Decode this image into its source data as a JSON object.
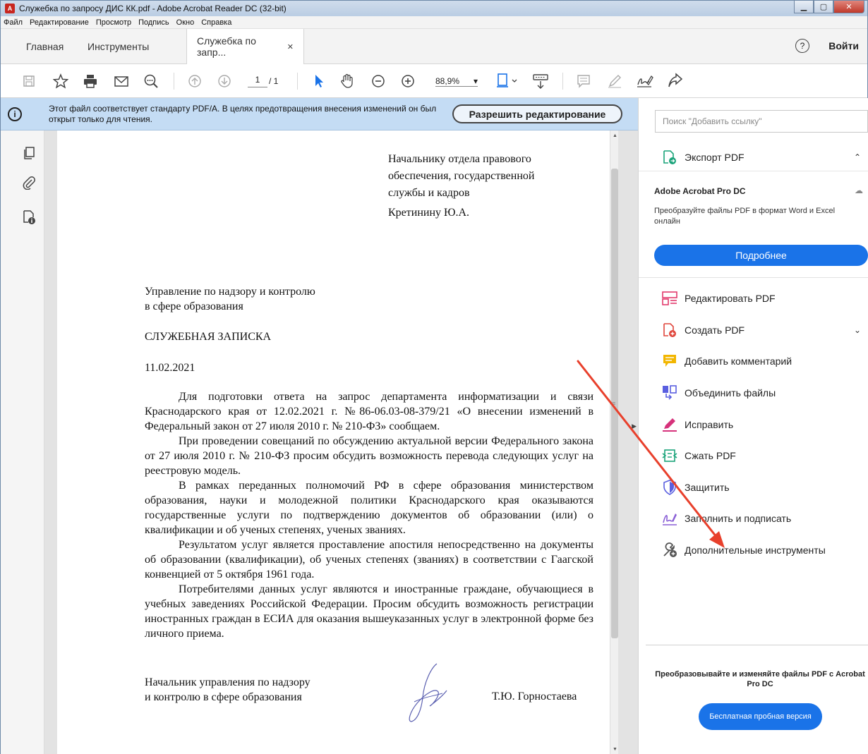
{
  "window": {
    "title": "Служебка по запросу ДИС КК.pdf - Adobe Acrobat Reader DC (32-bit)",
    "app_icon_glyph": "A"
  },
  "menu": [
    "Файл",
    "Редактирование",
    "Просмотр",
    "Подпись",
    "Окно",
    "Справка"
  ],
  "tabs": {
    "home": "Главная",
    "tools": "Инструменты",
    "document": "Служебка по запр...",
    "close_glyph": "✕"
  },
  "header": {
    "help_glyph": "?",
    "login": "Войти"
  },
  "toolbar": {
    "page_current": "1",
    "page_total": "/ 1",
    "zoom": "88,9%",
    "zoom_arrow": "▾"
  },
  "infobar": {
    "icon_glyph": "i",
    "message": "Этот файл соответствует стандарту PDF/A. В целях предотвращения внесения изменений он был открыт только для чтения.",
    "enable_button": "Разрешить редактирование"
  },
  "document": {
    "addressee": [
      "Начальнику отдела правового",
      "обеспечения, государственной",
      "службы и кадров"
    ],
    "addressee_name": "Кретинину Ю.А.",
    "department": [
      "Управление по надзору и контролю",
      "в сфере образования"
    ],
    "title": "СЛУЖЕБНАЯ ЗАПИСКА",
    "date": "11.02.2021",
    "paragraphs": [
      "Для подготовки ответа на запрос департамента информатизации и связи Краснодарского края от 12.02.2021 г. №86-06.03-08-379/21 «О внесении изменений в Федеральный закон от 27 июля 2010 г. № 210-ФЗ» сообщаем.",
      "При проведении совещаний по обсуждению актуальной версии Федерального закона от 27 июля 2010 г. № 210-ФЗ просим обсудить возможность перевода следующих услуг на реестровую модель.",
      "В рамках переданных полномочий РФ в сфере образования министерством образования, науки и молодежной политики Краснодарского края оказываются государственные услуги по подтверждению документов об образовании (или) о квалификации и об ученых степенях, ученых званиях.",
      "Результатом услуг является проставление апостиля непосредственно на документы об образовании (квалификации), об ученых степенях (званиях) в соответствии с Гаагской конвенцией от 5 октября 1961 года.",
      "Потребителями данных услуг являются и иностранные граждане, обучающиеся в учебных заведениях Российской Федерации. Просим обсудить возможность регистрации иностранных граждан в ЕСИА для оказания вышеуказанных услуг в электронной форме без личного приема."
    ],
    "signer_position": [
      "Начальник управления по надзору",
      "и контролю в сфере образования"
    ],
    "signer_name": "Т.Ю. Горностаева"
  },
  "rightpane": {
    "search_placeholder": "Поиск \"Добавить ссылку\"",
    "export_label": "Экспорт PDF",
    "promo_title": "Adobe Acrobat Pro DC",
    "promo_desc": "Преобразуйте файлы PDF в формат Word и Excel онлайн",
    "more_button": "Подробнее",
    "tools": [
      {
        "label": "Редактировать PDF",
        "icon": "edit-pdf-icon",
        "color": "#e33b6d"
      },
      {
        "label": "Создать PDF",
        "icon": "create-pdf-icon",
        "color": "#e0463c"
      },
      {
        "label": "Добавить комментарий",
        "icon": "comment-icon",
        "color": "#f2b600"
      },
      {
        "label": "Объединить файлы",
        "icon": "combine-files-icon",
        "color": "#5a5fe0"
      },
      {
        "label": "Исправить",
        "icon": "fix-pen-icon",
        "color": "#d6327b"
      },
      {
        "label": "Сжать PDF",
        "icon": "compress-pdf-icon",
        "color": "#1aa37a"
      },
      {
        "label": "Защитить",
        "icon": "protect-shield-icon",
        "color": "#5a5fe0"
      },
      {
        "label": "Заполнить и подписать",
        "icon": "fill-sign-icon",
        "color": "#8a5fd6"
      },
      {
        "label": "Дополнительные инструменты",
        "icon": "more-tools-icon",
        "color": "#555555"
      }
    ],
    "bottom_promo": "Преобразовывайте и изменяйте файлы PDF с Acrobat Pro DC",
    "trial_button": "Бесплатная пробная версия"
  },
  "colors": {
    "accent": "#1a73e8",
    "infobar": "#c4dcf4",
    "arrow": "#e8402c"
  }
}
